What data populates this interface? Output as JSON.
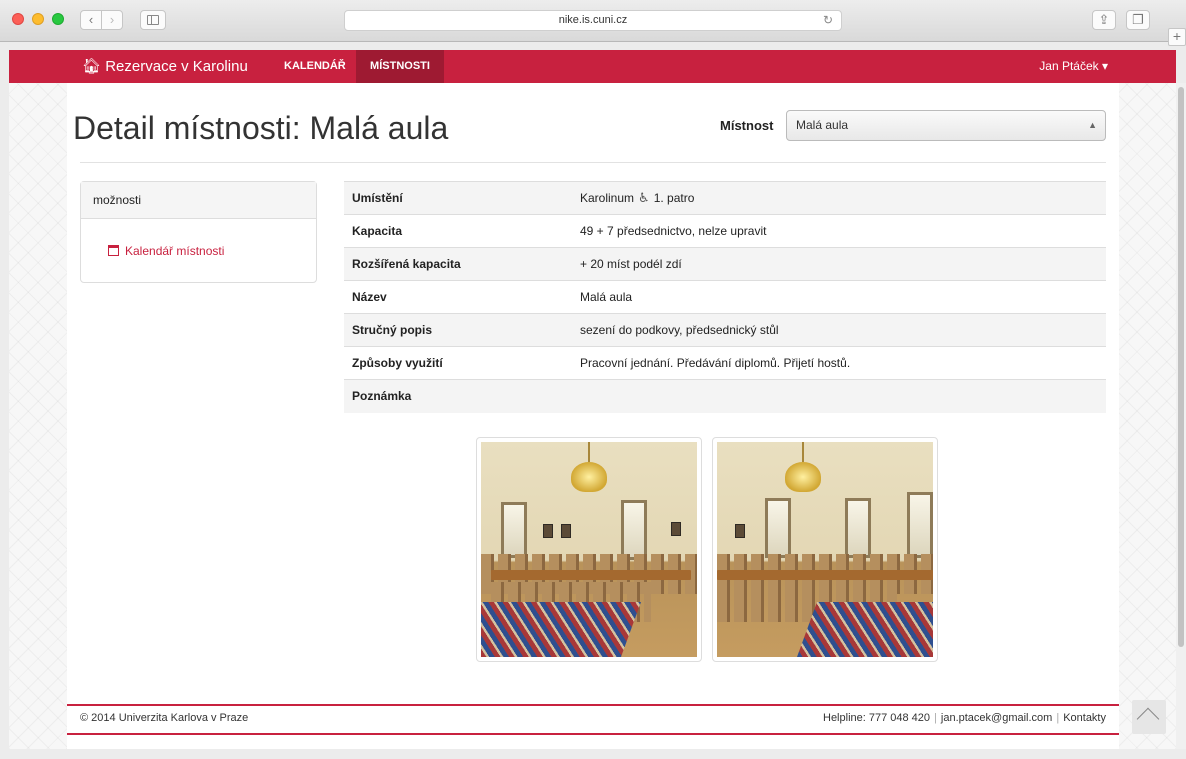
{
  "browser": {
    "url": "nike.is.cuni.cz",
    "back_glyph": "‹",
    "forward_glyph": "›",
    "reload_glyph": "↻",
    "share_glyph": "⇪",
    "tabs_glyph": "❐",
    "plus_glyph": "+"
  },
  "navbar": {
    "brand": "Rezervace v Karolinu",
    "links": [
      "KALENDÁŘ",
      "MÍSTNOSTI"
    ],
    "user": "Jan Ptáček ▾",
    "accent_color": "#c8213f"
  },
  "page": {
    "title": "Detail místnosti: Malá aula",
    "room_label": "Místnost",
    "room_selected": "Malá aula"
  },
  "panel": {
    "heading": "možnosti",
    "link": "Kalendář místnosti"
  },
  "details": [
    {
      "key": "Umístění",
      "value_before": "Karolinum",
      "icon": "wheelchair-icon",
      "value_after": "1. patro"
    },
    {
      "key": "Kapacita",
      "value": "49 + 7 předsednictvo, nelze upravit"
    },
    {
      "key": "Rozšířená kapacita",
      "value": "+ 20 míst podél zdí"
    },
    {
      "key": "Název",
      "value": "Malá aula"
    },
    {
      "key": "Stručný popis",
      "value": "sezení do podkovy, předsednický stůl"
    },
    {
      "key": "Způsoby využití",
      "value": "Pracovní jednání. Předávání diplomů. Přijetí hostů."
    },
    {
      "key": "Poznámka",
      "value": ""
    }
  ],
  "footer": {
    "copyright": "© 2014 Univerzita Karlova v Praze",
    "helpline": "Helpline: 777 048 420",
    "email": "jan.ptacek@gmail.com",
    "contacts": "Kontakty",
    "separator": "|"
  }
}
